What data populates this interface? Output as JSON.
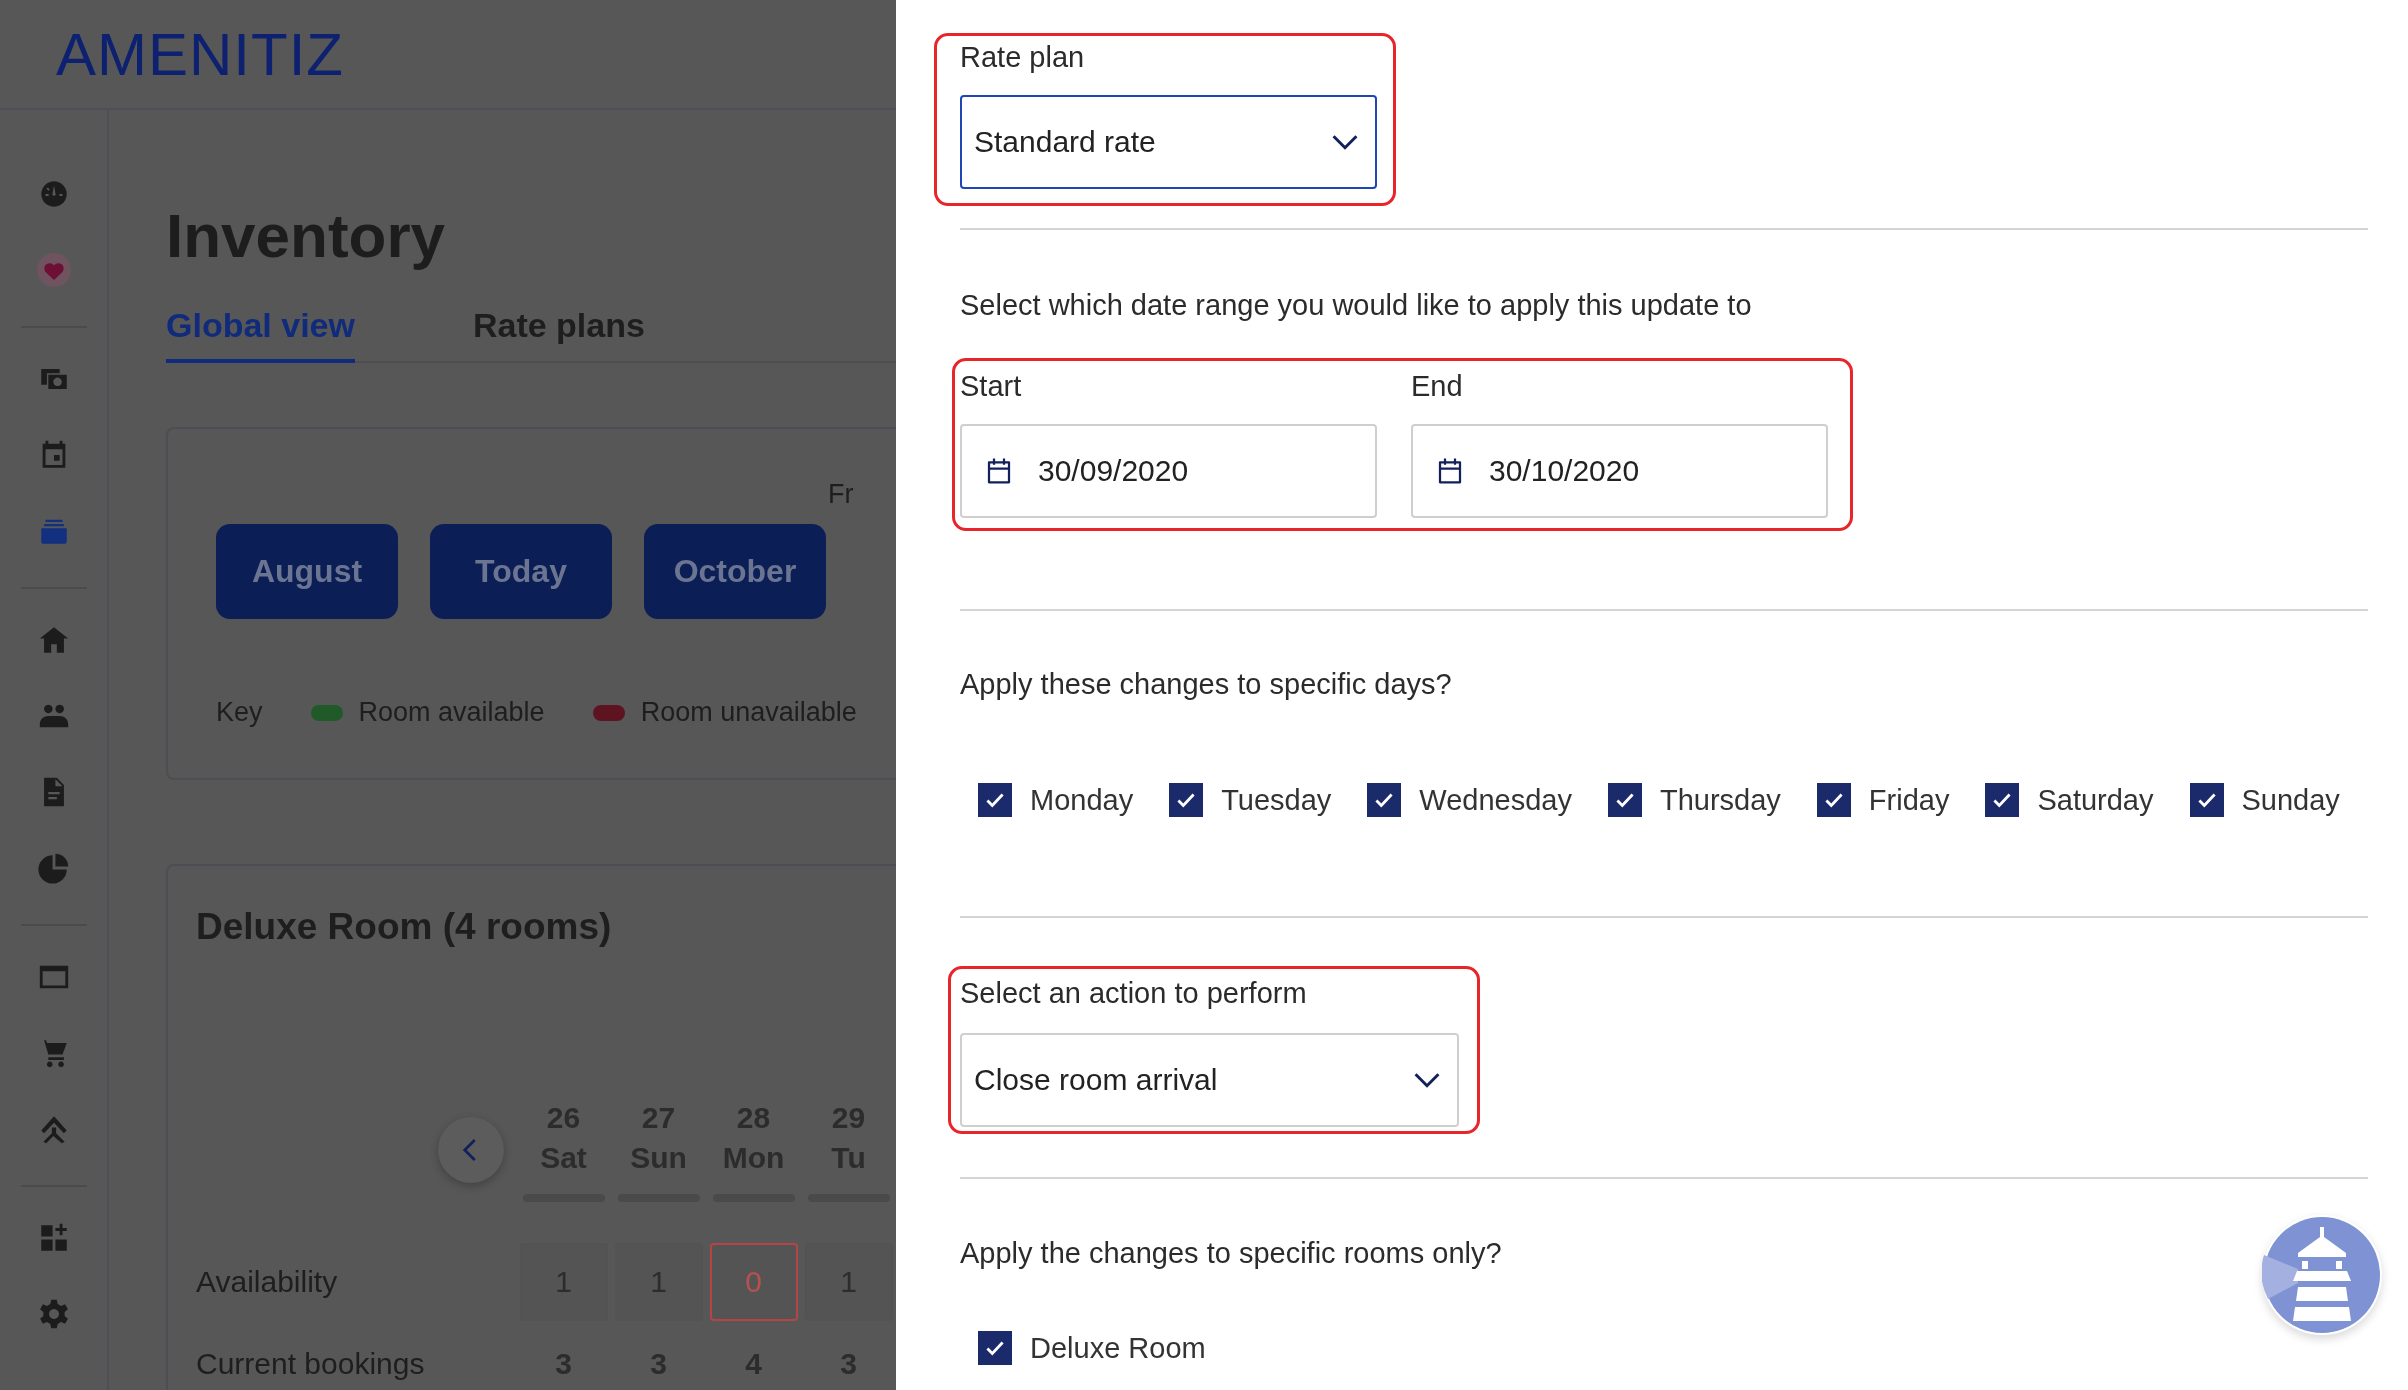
{
  "app": {
    "logo": "AMENITIZ",
    "sidebar": {
      "groups": [
        [
          {
            "selected": false
          },
          {
            "selected": false
          }
        ],
        [
          {
            "selected": false
          },
          {
            "selected": false
          },
          {
            "selected": true
          }
        ],
        [
          {
            "selected": false
          },
          {
            "selected": false
          },
          {
            "selected": false
          },
          {
            "selected": false
          }
        ],
        [
          {
            "selected": false
          },
          {
            "selected": false
          },
          {
            "selected": false
          }
        ],
        [
          {
            "selected": false
          },
          {
            "selected": false
          }
        ]
      ]
    },
    "page": {
      "title": "Inventory",
      "tabs": [
        {
          "label": "Global view",
          "selected": true
        },
        {
          "label": "Rate plans",
          "selected": false
        }
      ],
      "nav_buttons": [
        "August",
        "Today",
        "October"
      ],
      "from_label": "Fr",
      "legend": {
        "label": "Key",
        "items": [
          {
            "label": "Room available",
            "color": "#1f5a28"
          },
          {
            "label": "Room unavailable",
            "color": "#5e1420"
          }
        ]
      },
      "room": {
        "title": "Deluxe Room (4 rooms)",
        "days": [
          {
            "date": "26",
            "weekday": "Sat"
          },
          {
            "date": "27",
            "weekday": "Sun"
          },
          {
            "date": "28",
            "weekday": "Mon"
          },
          {
            "date": "29",
            "weekday": "Tu"
          }
        ],
        "availability": {
          "label": "Availability",
          "cells": [
            {
              "value": "1",
              "unavailable": false
            },
            {
              "value": "1",
              "unavailable": false
            },
            {
              "value": "0",
              "unavailable": true
            },
            {
              "value": "1",
              "unavailable": false
            }
          ]
        },
        "bookings": {
          "label": "Current bookings",
          "cells": [
            "3",
            "3",
            "4",
            "3"
          ]
        }
      }
    }
  },
  "drawer": {
    "rate_plan": {
      "label": "Rate plan",
      "value": "Standard rate",
      "focused": true,
      "highlighted": true
    },
    "date_range": {
      "prompt": "Select which date range you would like to apply this update to",
      "highlighted": true,
      "start": {
        "label": "Start",
        "value": "30/09/2020"
      },
      "end": {
        "label": "End",
        "value": "30/10/2020"
      }
    },
    "days": {
      "prompt": "Apply these changes to specific days?",
      "items": [
        {
          "label": "Monday",
          "checked": true
        },
        {
          "label": "Tuesday",
          "checked": true
        },
        {
          "label": "Wednesday",
          "checked": true
        },
        {
          "label": "Thursday",
          "checked": true
        },
        {
          "label": "Friday",
          "checked": true
        },
        {
          "label": "Saturday",
          "checked": true
        },
        {
          "label": "Sunday",
          "checked": true
        }
      ]
    },
    "action": {
      "label": "Select an action to perform",
      "value": "Close room arrival",
      "focused": false,
      "highlighted": true
    },
    "rooms": {
      "prompt": "Apply the changes to specific rooms only?",
      "items": [
        {
          "label": "Deluxe Room",
          "checked": true
        }
      ]
    }
  }
}
